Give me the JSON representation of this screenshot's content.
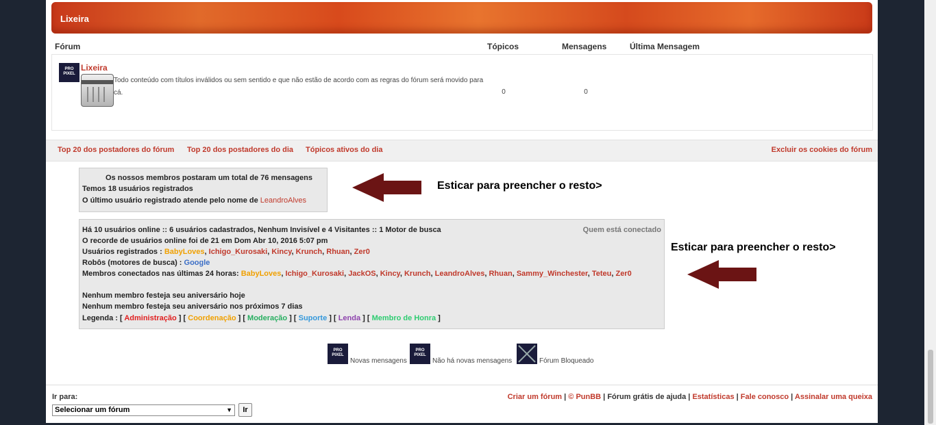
{
  "category": {
    "title": "Lixeira"
  },
  "table_headers": {
    "forum": "Fórum",
    "topics": "Tópicos",
    "messages": "Mensagens",
    "last": "Última Mensagem"
  },
  "forum": {
    "name": "Lixeira",
    "description": "Todo conteúdo com títulos inválidos ou sem sentido e que não estão de acordo com as regras do fórum será movido para cá.",
    "topics": "0",
    "messages": "0",
    "icon_text": "PRO PIXEL"
  },
  "links": {
    "top20": "Top 20 dos postadores do fórum",
    "top20day": "Top 20 dos postadores do dia",
    "active": "Tópicos ativos do dia",
    "cookies": "Excluir os cookies do fórum"
  },
  "stats": {
    "line1": "Os nossos membros postaram um total de 76 mensagens",
    "line2": "Temos 18 usuários registrados",
    "line3_prefix": "O último usuário registrado atende pelo nome de ",
    "last_user": "LeandroAlves"
  },
  "annotations": {
    "a1": "Esticar para preencher o resto>",
    "a2": "Esticar para preencher o resto>"
  },
  "online": {
    "summary": "Há 10 usuários online :: 6 usuários cadastrados, Nenhum Invisível e 4 Visitantes :: 1 Motor de busca",
    "who_link": "Quem está conectado",
    "record": "O recorde de usuários online foi de 21 em Dom Abr 10, 2016 5:07 pm",
    "registered_label": "Usuários registrados : ",
    "registered": [
      "BabyLoves",
      "Ichigo_Kurosaki",
      "Kincy",
      "Krunch",
      "Rhuan",
      "Zer0"
    ],
    "bots_label": "Robôs (motores de busca) : ",
    "bot": "Google",
    "last24_label": "Membros conectados nas últimas 24 horas: ",
    "last24": [
      "BabyLoves",
      "Ichigo_Kurosaki",
      "JackOS",
      "Kincy",
      "Krunch",
      "LeandroAlves",
      "Rhuan",
      "Sammy_Winchester",
      "Teteu",
      "Zer0"
    ],
    "birthday_today": "Nenhum membro festeja seu aniversário hoje",
    "birthday_week": "Nenhum membro festeja seu aniversário nos próximos 7 dias",
    "legend_label": "Legenda : ",
    "legend": [
      "Administração",
      "Coordenação",
      "Moderação",
      "Suporte",
      "Lenda",
      "Membro de Honra"
    ]
  },
  "icons_legend": {
    "new": "Novas mensagens",
    "no_new": "Não há novas mensagens",
    "locked": "Fórum Bloqueado"
  },
  "footer": {
    "jump_label": "Ir para:",
    "jump_select": "Selecionar um fórum",
    "jump_button": "Ir",
    "links": [
      "Criar um fórum",
      "© PunBB",
      "Fórum grátis de ajuda",
      "Estatísticas",
      "Fale conosco",
      "Assinalar uma queixa"
    ]
  },
  "colors": {
    "accent": "#c0392b",
    "header_orange": "#e16a2a",
    "arrow": "#6b1414"
  }
}
